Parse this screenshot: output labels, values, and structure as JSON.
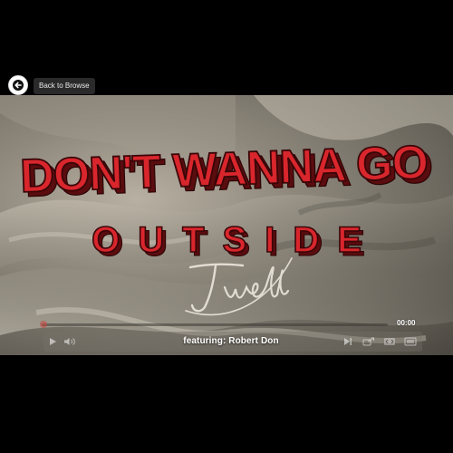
{
  "nav": {
    "back_label": "Back to Browse"
  },
  "video": {
    "title_line1": "DON'T WANNA GO",
    "title_line2": "OUTSIDE",
    "featuring": "featuring: Robert Don",
    "time": "00:00"
  },
  "player": {
    "progress": 0,
    "icons": [
      "play-icon",
      "volume-icon",
      "next-track-icon",
      "share-icon",
      "embed-icon",
      "fullscreen-icon"
    ]
  },
  "colors": {
    "title_red": "#d8262c",
    "title_shadow": "#5a0c0e"
  }
}
